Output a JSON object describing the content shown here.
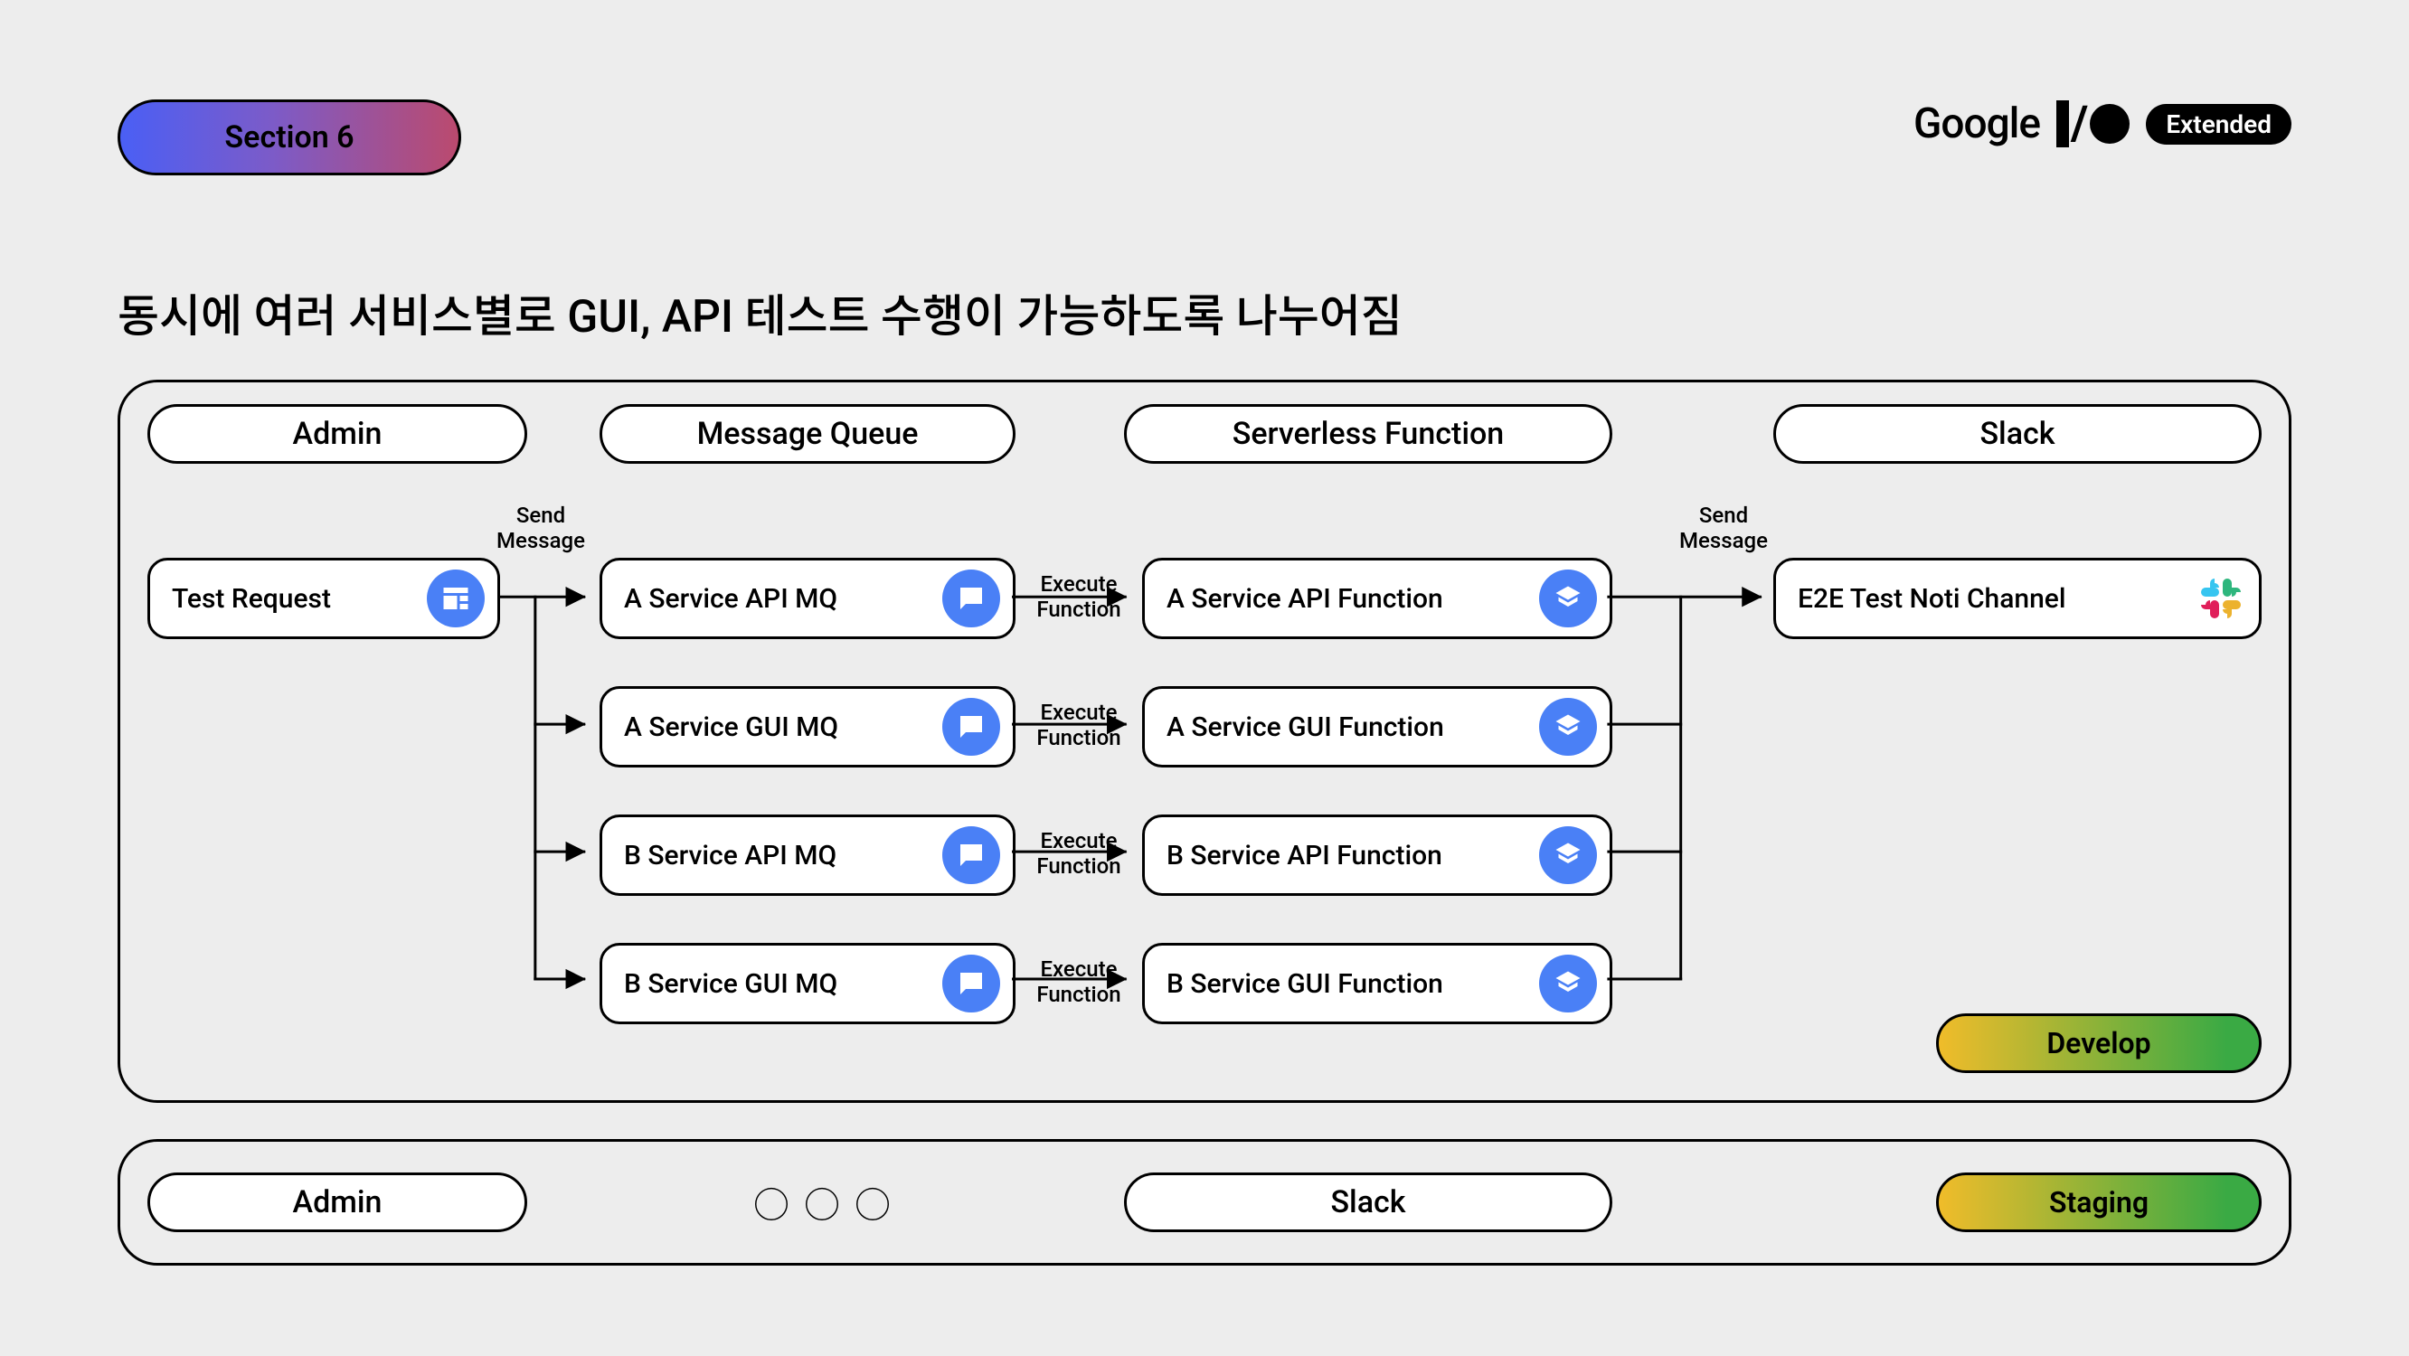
{
  "header": {
    "section_label": "Section 6",
    "brand_google": "Google",
    "brand_extended": "Extended"
  },
  "title": "동시에 여러 서비스별로 GUI, API 테스트 수행이 가능하도록 나누어짐",
  "develop": {
    "columns": {
      "admin": "Admin",
      "mq": "Message Queue",
      "fn": "Serverless Function",
      "slack": "Slack"
    },
    "nodes": {
      "test_request": "Test Request",
      "mq": [
        "A Service API MQ",
        "A Service GUI MQ",
        "B Service API MQ",
        "B Service GUI MQ"
      ],
      "fn": [
        "A Service API Function",
        "A Service GUI Function",
        "B Service API Function",
        "B Service GUI Function"
      ],
      "slack_channel": "E2E Test Noti Channel"
    },
    "arrows": {
      "send_msg_left": "Send\nMessage",
      "execute_fn": "Execute\nFunction",
      "send_msg_right": "Send\nMessage"
    },
    "env_badge": "Develop"
  },
  "staging": {
    "admin": "Admin",
    "slack": "Slack",
    "dots": "○○○",
    "env_badge": "Staging"
  }
}
